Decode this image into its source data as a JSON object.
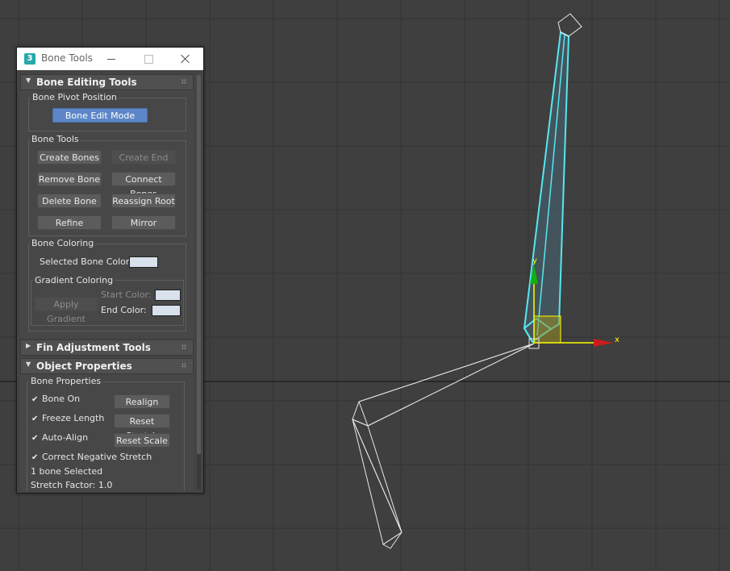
{
  "window": {
    "app_icon_label": "3",
    "title": "Bone Tools"
  },
  "bone_editing": {
    "header": "Bone Editing Tools",
    "pivot_group_label": "Bone Pivot Position",
    "bone_edit_mode": "Bone Edit Mode",
    "tools_group_label": "Bone Tools",
    "create_bones": "Create Bones",
    "create_end": "Create End",
    "remove_bone": "Remove Bone",
    "connect_bones": "Connect Bones",
    "delete_bone": "Delete Bone",
    "reassign_root": "Reassign Root",
    "refine": "Refine",
    "mirror": "Mirror",
    "coloring_group_label": "Bone Coloring",
    "selected_bone_color_label": "Selected Bone Color:",
    "gradient_group_label": "Gradient Coloring",
    "apply_gradient": "Apply Gradient",
    "start_color_label": "Start Color:",
    "end_color_label": "End Color:"
  },
  "fin_adjustment": {
    "header": "Fin Adjustment Tools"
  },
  "object_properties": {
    "header": "Object Properties",
    "group_label": "Bone Properties",
    "bone_on": "Bone On",
    "realign": "Realign",
    "freeze_length": "Freeze Length",
    "reset_stretch": "Reset Stretch",
    "auto_align": "Auto-Align",
    "reset_scale": "Reset Scale",
    "correct_negative_stretch": "Correct Negative Stretch",
    "selected_count": "1 bone Selected",
    "stretch_factor": "Stretch Factor: 1.0"
  },
  "gizmo": {
    "x_label": "x",
    "y_label": "y"
  },
  "colors": {
    "viewport_bg": "#3f3f3f",
    "grid_line": "#333333",
    "selected_bone": "#55e8f0",
    "wire_bone": "#e8e8e8",
    "axis_x": "#ffff00",
    "axis_y": "#00cc00"
  }
}
